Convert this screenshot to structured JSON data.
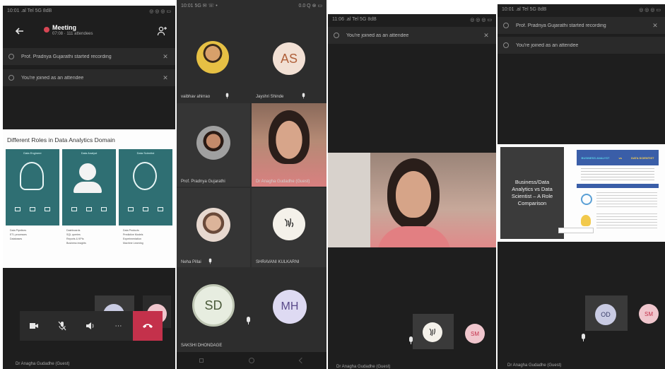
{
  "screen1": {
    "status_left": "10:01 .al Tel 5G 8dB",
    "status_right": "◎ ◎ ◎ ▭",
    "header": {
      "back_icon": "arrow-left-icon",
      "title": "Meeting",
      "subtitle": "07:08 · 111 attendees",
      "participants_icon": "people-icon"
    },
    "notices": [
      "Prof. Pradnya Gujarathi started recording",
      "You're joined as an attendee"
    ],
    "slide": {
      "title": "Different Roles in Data Analytics Domain",
      "columns": [
        {
          "heading": "Data Engineer",
          "bullets": [
            "Data Pipelines",
            "ETL processes",
            "Databases"
          ]
        },
        {
          "heading": "Data Analyst",
          "bullets": [
            "Dashboards",
            "SQL queries",
            "Reports & KPIs",
            "Business insights"
          ]
        },
        {
          "heading": "Data Scientist",
          "bullets": [
            "Data Products",
            "Predictive Models",
            "Experimentation",
            "Machine Learning"
          ]
        }
      ]
    },
    "controls": [
      "camera-icon",
      "mic-muted-icon",
      "speaker-icon",
      "more-icon",
      "hang-up-icon"
    ],
    "self_initials": "OD",
    "second_initials": "SM",
    "bottom_name": "Dr Anagha Gudadhe (Guest)",
    "colors": {
      "hangup": "#c4314b",
      "slide_teal": "#2f6f73",
      "record": "#d74654"
    }
  },
  "screen2": {
    "status_left": "10:01 5G ✉ ☏ •",
    "status_right": "0.0 Q ⊗ ▭",
    "tiles": [
      {
        "name": "vaibhav ahirrao",
        "initials": ""
      },
      {
        "name": "Jayshri Shinde",
        "initials": "AS"
      },
      {
        "name": "Prof. Pradnya Gujarathi",
        "initials": ""
      },
      {
        "name": "Dr Anagha Gudadhe (Guest)",
        "initials": ""
      },
      {
        "name": "Neha Pillai",
        "initials": ""
      },
      {
        "name": "SHRAVANI KULKARNI",
        "initials": ""
      },
      {
        "name": "SAKSHI DHONDAGE",
        "initials": "SD"
      },
      {
        "name": "",
        "initials": "MH"
      }
    ],
    "colors": {
      "as_bg": "#f2e0d4",
      "sd_bg": "#e7ede0",
      "mh_bg": "#dedaf2"
    }
  },
  "screen3": {
    "status_left": "11:06 .al Tel 5G 8dB",
    "status_right": "◎ ◎ ◎ ▭",
    "notice": "You're joined as an attendee",
    "self_initials": "SM",
    "bottom_name": "Dr Anagha Gudadhe (Guest)"
  },
  "screen4": {
    "status_left": "10:01 .al Tel 5G 8dB",
    "status_right": "◎ ◎ ◎ ▭",
    "notices": [
      "Prof. Pradnya Gujarathi started recording",
      "You're joined as an attendee"
    ],
    "slide": {
      "left_text": "Business/Data Analytics vs Data Scientist – A Role Comparison",
      "banner_left": "BUSINESS ANALYST",
      "banner_mid": "vs",
      "banner_right": "DATA SCIENTIST"
    },
    "self_initials": "OD",
    "second_initials": "SM",
    "bottom_name": "Dr Anagha Gudadhe (Guest)"
  }
}
